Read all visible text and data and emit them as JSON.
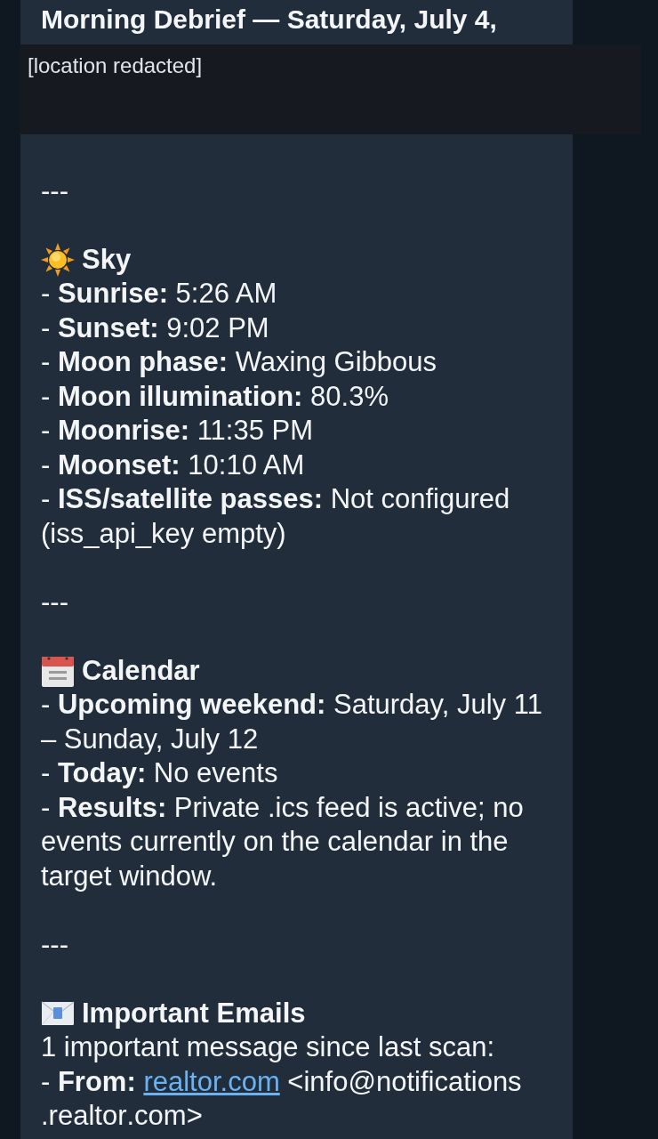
{
  "message": {
    "title": "Morning Debrief — Saturday, July 4,",
    "redaction": {
      "label": "[location redacted]"
    },
    "sections": [
      {
        "kind": "sky",
        "divider": "---",
        "heading": "Sky",
        "lines": [
          {
            "kind": "item",
            "text": "- **Sunrise:** 5:26 AM"
          },
          {
            "kind": "item",
            "text": "- **Sunset:** 9:02 PM"
          },
          {
            "kind": "item",
            "text": "- **Moon phase:** Waxing Gibbous"
          },
          {
            "kind": "item",
            "text": "- **Moon illumination:** 80.3%"
          },
          {
            "kind": "item",
            "text": "- **Moonrise:** 11:35 PM"
          },
          {
            "kind": "item",
            "text": "- **Moonset:** 10:10 AM"
          },
          {
            "kind": "item",
            "text": "- **ISS/satellite passes:** Not configured (iss_api_key empty)"
          }
        ]
      },
      {
        "kind": "calendar",
        "divider": "---",
        "heading": "Calendar",
        "lines": [
          {
            "kind": "item",
            "text": "- **Upcoming weekend:** Saturday, July 11 – Sunday, July 12"
          },
          {
            "kind": "item",
            "text": "- **Today:** No events"
          },
          {
            "kind": "item",
            "text": "- **Results:** Private .ics feed is active; no events currently on the calendar in the target window."
          }
        ]
      },
      {
        "kind": "emails",
        "divider": "---",
        "heading": "Important Emails",
        "lines": [
          {
            "kind": "text",
            "text": "1 important message since last scan:"
          },
          {
            "kind": "link_item",
            "prefix": "- **From:**",
            "link": "realtor.com",
            "suffix": "<info@notifications.realtor.com>"
          }
        ]
      }
    ]
  }
}
